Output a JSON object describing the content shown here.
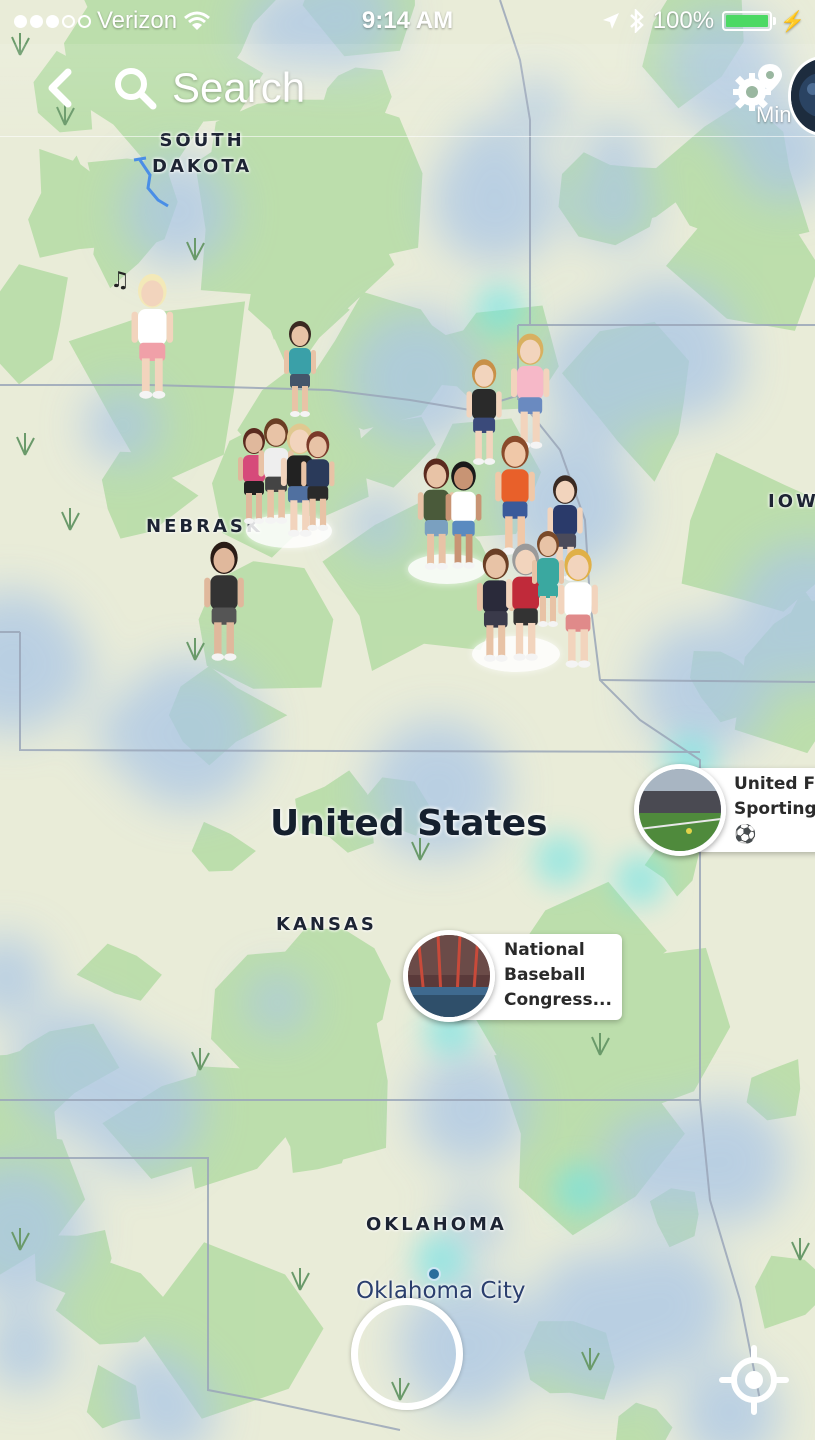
{
  "status_bar": {
    "carrier": "Verizon",
    "time": "9:14 AM",
    "battery": "100%",
    "battery_level": 1.0,
    "signal_bars_filled": 3,
    "signal_bars_total": 5
  },
  "header": {
    "search_label": "Search",
    "mini_label": "Min"
  },
  "map_labels": {
    "south_dakota_line1": "SOUTH",
    "south_dakota_line2": "DAKOTA",
    "nebraska": "NEBRASK",
    "iowa": "IOW",
    "kansas": "KANSAS",
    "oklahoma": "OKLAHOMA",
    "country": "United States",
    "city": "Oklahoma City"
  },
  "events": [
    {
      "lines": [
        "National",
        "Baseball",
        "Congress..."
      ]
    },
    {
      "lines": [
        "United FC",
        "Sporting"
      ],
      "icon": "soccer-ball-icon"
    }
  ],
  "icons": {
    "back": "chevron-left-icon",
    "search": "search-icon",
    "settings": "gear-location-icon",
    "locate": "crosshair-icon",
    "music": "music-note-icon"
  },
  "colors": {
    "map_base": "#e9ecd8",
    "map_green": "#b5dca5",
    "heat_blue": "#aac6e6",
    "heat_cyan": "#6be4e6",
    "border": "#9aa6b8",
    "battery_green": "#4cd964",
    "label_dark": "#1d2433",
    "city_blue": "#2b3f6e"
  }
}
